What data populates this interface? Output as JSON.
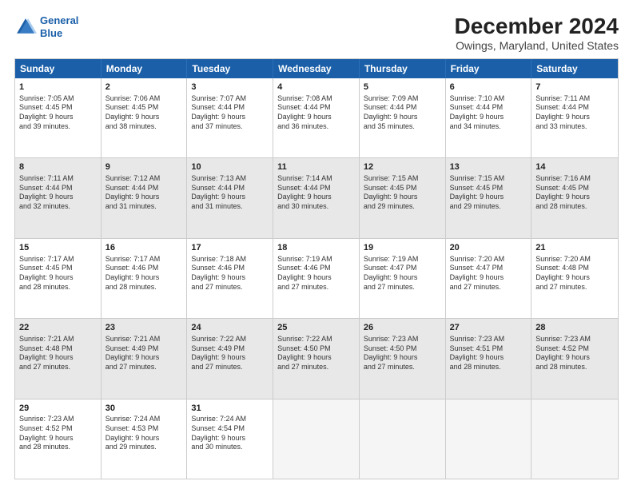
{
  "logo": {
    "line1": "General",
    "line2": "Blue"
  },
  "title": "December 2024",
  "subtitle": "Owings, Maryland, United States",
  "days": [
    "Sunday",
    "Monday",
    "Tuesday",
    "Wednesday",
    "Thursday",
    "Friday",
    "Saturday"
  ],
  "weeks": [
    [
      {
        "day": "1",
        "sunrise": "Sunrise: 7:05 AM",
        "sunset": "Sunset: 4:45 PM",
        "daylight": "Daylight: 9 hours",
        "minutes": "and 39 minutes."
      },
      {
        "day": "2",
        "sunrise": "Sunrise: 7:06 AM",
        "sunset": "Sunset: 4:45 PM",
        "daylight": "Daylight: 9 hours",
        "minutes": "and 38 minutes."
      },
      {
        "day": "3",
        "sunrise": "Sunrise: 7:07 AM",
        "sunset": "Sunset: 4:44 PM",
        "daylight": "Daylight: 9 hours",
        "minutes": "and 37 minutes."
      },
      {
        "day": "4",
        "sunrise": "Sunrise: 7:08 AM",
        "sunset": "Sunset: 4:44 PM",
        "daylight": "Daylight: 9 hours",
        "minutes": "and 36 minutes."
      },
      {
        "day": "5",
        "sunrise": "Sunrise: 7:09 AM",
        "sunset": "Sunset: 4:44 PM",
        "daylight": "Daylight: 9 hours",
        "minutes": "and 35 minutes."
      },
      {
        "day": "6",
        "sunrise": "Sunrise: 7:10 AM",
        "sunset": "Sunset: 4:44 PM",
        "daylight": "Daylight: 9 hours",
        "minutes": "and 34 minutes."
      },
      {
        "day": "7",
        "sunrise": "Sunrise: 7:11 AM",
        "sunset": "Sunset: 4:44 PM",
        "daylight": "Daylight: 9 hours",
        "minutes": "and 33 minutes."
      }
    ],
    [
      {
        "day": "8",
        "sunrise": "Sunrise: 7:11 AM",
        "sunset": "Sunset: 4:44 PM",
        "daylight": "Daylight: 9 hours",
        "minutes": "and 32 minutes."
      },
      {
        "day": "9",
        "sunrise": "Sunrise: 7:12 AM",
        "sunset": "Sunset: 4:44 PM",
        "daylight": "Daylight: 9 hours",
        "minutes": "and 31 minutes."
      },
      {
        "day": "10",
        "sunrise": "Sunrise: 7:13 AM",
        "sunset": "Sunset: 4:44 PM",
        "daylight": "Daylight: 9 hours",
        "minutes": "and 31 minutes."
      },
      {
        "day": "11",
        "sunrise": "Sunrise: 7:14 AM",
        "sunset": "Sunset: 4:44 PM",
        "daylight": "Daylight: 9 hours",
        "minutes": "and 30 minutes."
      },
      {
        "day": "12",
        "sunrise": "Sunrise: 7:15 AM",
        "sunset": "Sunset: 4:45 PM",
        "daylight": "Daylight: 9 hours",
        "minutes": "and 29 minutes."
      },
      {
        "day": "13",
        "sunrise": "Sunrise: 7:15 AM",
        "sunset": "Sunset: 4:45 PM",
        "daylight": "Daylight: 9 hours",
        "minutes": "and 29 minutes."
      },
      {
        "day": "14",
        "sunrise": "Sunrise: 7:16 AM",
        "sunset": "Sunset: 4:45 PM",
        "daylight": "Daylight: 9 hours",
        "minutes": "and 28 minutes."
      }
    ],
    [
      {
        "day": "15",
        "sunrise": "Sunrise: 7:17 AM",
        "sunset": "Sunset: 4:45 PM",
        "daylight": "Daylight: 9 hours",
        "minutes": "and 28 minutes."
      },
      {
        "day": "16",
        "sunrise": "Sunrise: 7:17 AM",
        "sunset": "Sunset: 4:46 PM",
        "daylight": "Daylight: 9 hours",
        "minutes": "and 28 minutes."
      },
      {
        "day": "17",
        "sunrise": "Sunrise: 7:18 AM",
        "sunset": "Sunset: 4:46 PM",
        "daylight": "Daylight: 9 hours",
        "minutes": "and 27 minutes."
      },
      {
        "day": "18",
        "sunrise": "Sunrise: 7:19 AM",
        "sunset": "Sunset: 4:46 PM",
        "daylight": "Daylight: 9 hours",
        "minutes": "and 27 minutes."
      },
      {
        "day": "19",
        "sunrise": "Sunrise: 7:19 AM",
        "sunset": "Sunset: 4:47 PM",
        "daylight": "Daylight: 9 hours",
        "minutes": "and 27 minutes."
      },
      {
        "day": "20",
        "sunrise": "Sunrise: 7:20 AM",
        "sunset": "Sunset: 4:47 PM",
        "daylight": "Daylight: 9 hours",
        "minutes": "and 27 minutes."
      },
      {
        "day": "21",
        "sunrise": "Sunrise: 7:20 AM",
        "sunset": "Sunset: 4:48 PM",
        "daylight": "Daylight: 9 hours",
        "minutes": "and 27 minutes."
      }
    ],
    [
      {
        "day": "22",
        "sunrise": "Sunrise: 7:21 AM",
        "sunset": "Sunset: 4:48 PM",
        "daylight": "Daylight: 9 hours",
        "minutes": "and 27 minutes."
      },
      {
        "day": "23",
        "sunrise": "Sunrise: 7:21 AM",
        "sunset": "Sunset: 4:49 PM",
        "daylight": "Daylight: 9 hours",
        "minutes": "and 27 minutes."
      },
      {
        "day": "24",
        "sunrise": "Sunrise: 7:22 AM",
        "sunset": "Sunset: 4:49 PM",
        "daylight": "Daylight: 9 hours",
        "minutes": "and 27 minutes."
      },
      {
        "day": "25",
        "sunrise": "Sunrise: 7:22 AM",
        "sunset": "Sunset: 4:50 PM",
        "daylight": "Daylight: 9 hours",
        "minutes": "and 27 minutes."
      },
      {
        "day": "26",
        "sunrise": "Sunrise: 7:23 AM",
        "sunset": "Sunset: 4:50 PM",
        "daylight": "Daylight: 9 hours",
        "minutes": "and 27 minutes."
      },
      {
        "day": "27",
        "sunrise": "Sunrise: 7:23 AM",
        "sunset": "Sunset: 4:51 PM",
        "daylight": "Daylight: 9 hours",
        "minutes": "and 28 minutes."
      },
      {
        "day": "28",
        "sunrise": "Sunrise: 7:23 AM",
        "sunset": "Sunset: 4:52 PM",
        "daylight": "Daylight: 9 hours",
        "minutes": "and 28 minutes."
      }
    ],
    [
      {
        "day": "29",
        "sunrise": "Sunrise: 7:23 AM",
        "sunset": "Sunset: 4:52 PM",
        "daylight": "Daylight: 9 hours",
        "minutes": "and 28 minutes."
      },
      {
        "day": "30",
        "sunrise": "Sunrise: 7:24 AM",
        "sunset": "Sunset: 4:53 PM",
        "daylight": "Daylight: 9 hours",
        "minutes": "and 29 minutes."
      },
      {
        "day": "31",
        "sunrise": "Sunrise: 7:24 AM",
        "sunset": "Sunset: 4:54 PM",
        "daylight": "Daylight: 9 hours",
        "minutes": "and 30 minutes."
      },
      null,
      null,
      null,
      null
    ]
  ]
}
